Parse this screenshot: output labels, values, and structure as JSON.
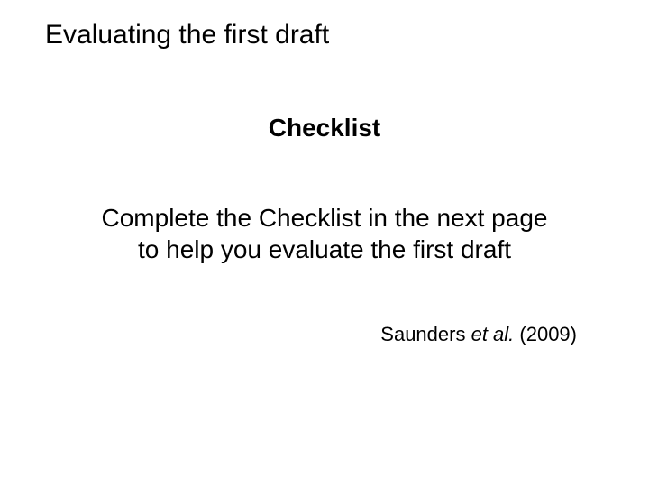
{
  "title": "Evaluating the first draft",
  "subtitle": "Checklist",
  "body_line1": "Complete the Checklist in the next page",
  "body_line2": "to help you evaluate the first draft",
  "citation_author": "Saunders ",
  "citation_etal": "et al.",
  "citation_year": " (2009)"
}
